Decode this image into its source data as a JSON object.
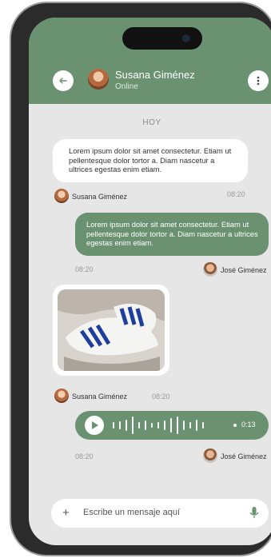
{
  "header": {
    "name": "Susana Giménez",
    "status": "Online"
  },
  "day_label": "HOY",
  "messages": {
    "m1": {
      "text": "Lorem ipsum dolor sit amet consectetur. Etiam ut pellentesque dolor tortor a. Diam nascetur a ultrices egestas enim etiam.",
      "sender": "Susana Giménez",
      "time": "08:20"
    },
    "m2": {
      "text": "Lorem ipsum dolor sit amet consectetur. Etiam ut pellentesque dolor tortor a. Diam nascetur a ultrices egestas enim etiam.",
      "sender": "José Giménez",
      "time": "08:20"
    },
    "m3": {
      "sender": "Susana Giménez",
      "time": "08:20"
    },
    "m4": {
      "duration": "0:13",
      "sender": "José Giménez",
      "time": "08:20"
    }
  },
  "composer": {
    "placeholder": "Escribe un mensaje aquí"
  },
  "colors": {
    "accent": "#6b9270",
    "background": "#e6e6e6"
  }
}
